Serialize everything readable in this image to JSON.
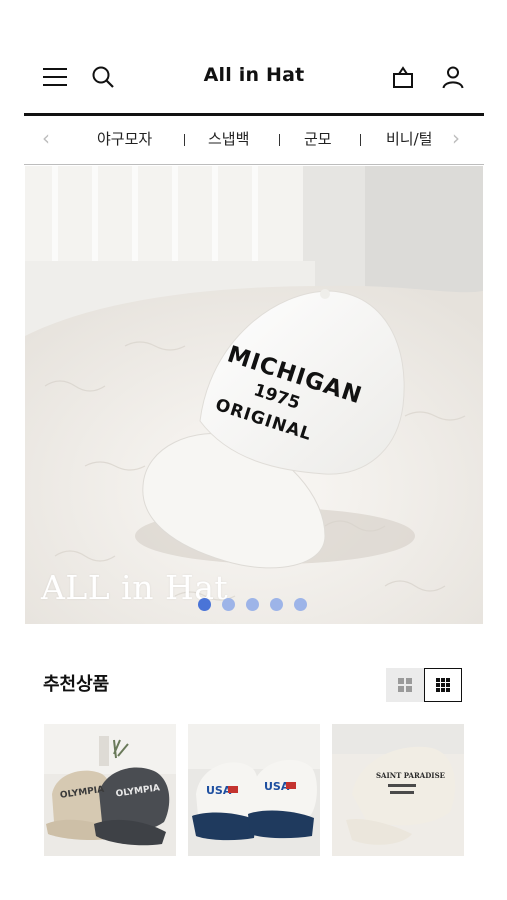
{
  "header": {
    "title": "All in Hat",
    "icons": [
      "menu-icon",
      "search-icon",
      "bag-icon",
      "user-icon"
    ]
  },
  "category_nav": {
    "items": [
      {
        "label": "야구모자"
      },
      {
        "label": "스냅백"
      },
      {
        "label": "군모"
      },
      {
        "label": "비니/털"
      }
    ]
  },
  "hero": {
    "caption": "ALL in Hat",
    "cap_text": {
      "line1": "MICHIGAN",
      "line2": "1975",
      "line3": "ORIGINAL"
    },
    "slides": 5,
    "active_slide": 1,
    "colors": {
      "dot_active": "#4a74d7",
      "dot_inactive": "#9db4e8"
    }
  },
  "recommended": {
    "title": "추천상품",
    "view_mode": "grid-3",
    "products": [
      {
        "cap_text": "OLYMPIA",
        "cap_text_2": "OLYMPIA"
      },
      {
        "cap_text": "USA",
        "cap_text_2": "USA"
      },
      {
        "cap_text": "SAINT PARADISE"
      }
    ]
  }
}
